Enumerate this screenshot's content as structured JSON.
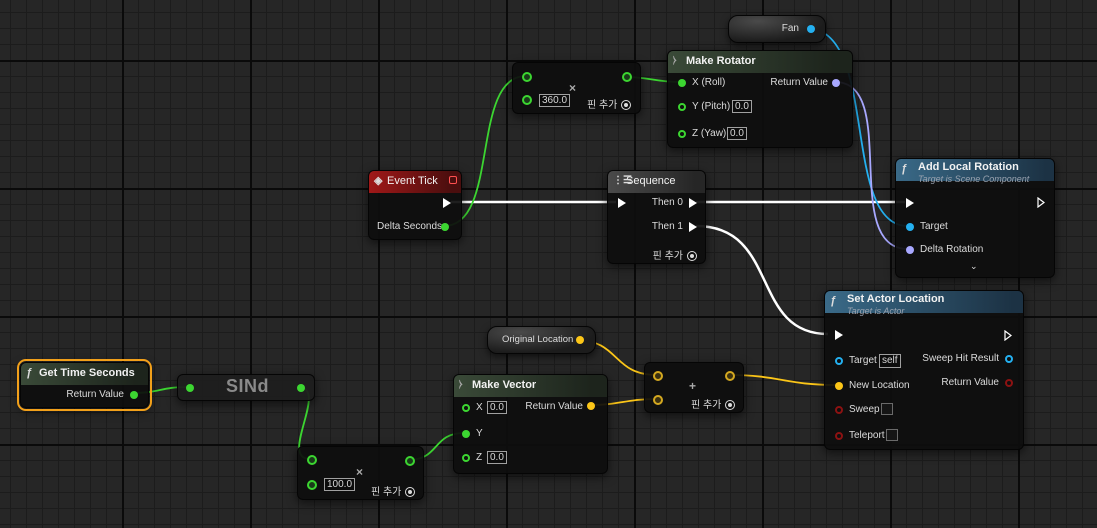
{
  "nodes": {
    "fan": {
      "label": "Fan"
    },
    "multiply_top": {
      "b_value": "360.0",
      "add_pin": "핀 추가"
    },
    "make_rotator": {
      "title": "Make Rotator",
      "x_label": "X (Roll)",
      "y_label": "Y (Pitch)",
      "y_value": "0.0",
      "z_label": "Z (Yaw)",
      "z_value": "0.0",
      "return_label": "Return Value"
    },
    "event_tick": {
      "title": "Event Tick",
      "delta_label": "Delta Seconds"
    },
    "sequence": {
      "title": "Sequence",
      "then0": "Then 0",
      "then1": "Then 1",
      "add_pin": "핀 추가"
    },
    "add_local_rotation": {
      "title": "Add Local Rotation",
      "subtitle": "Target is Scene Component",
      "target_label": "Target",
      "delta_label": "Delta Rotation"
    },
    "set_actor_location": {
      "title": "Set Actor Location",
      "subtitle": "Target is Actor",
      "target_label": "Target",
      "target_value": "self",
      "new_location_label": "New Location",
      "sweep_label": "Sweep",
      "teleport_label": "Teleport",
      "sweep_hit_label": "Sweep Hit Result",
      "return_label": "Return Value"
    },
    "original_location": {
      "label": "Original Location"
    },
    "add_vector": {
      "add_pin": "핀 추가"
    },
    "get_time_seconds": {
      "title": "Get Time Seconds",
      "return_label": "Return Value"
    },
    "sind": {
      "title": "SINd"
    },
    "make_vector": {
      "title": "Make Vector",
      "x_label": "X",
      "x_value": "0.0",
      "y_label": "Y",
      "z_label": "Z",
      "z_value": "0.0",
      "return_label": "Return Value"
    },
    "multiply_bottom": {
      "b_value": "100.0",
      "add_pin": "핀 추가"
    }
  },
  "colors": {
    "exec": "#ffffff",
    "float": "#3cd631",
    "object": "#24b0f0",
    "rotator": "#a8a8ff",
    "vector": "#fcc618",
    "bool": "#8c1212",
    "event_header": "#a01818",
    "function_header": "#3a6a88",
    "selection": "#f2a01a"
  },
  "icons": {
    "function": "function-icon",
    "event": "event-diamond-icon",
    "sequence": "sequence-icon",
    "struct": "struct-icon",
    "multiply": "multiply-icon",
    "add": "plus-icon",
    "chevron": "chevron-down-icon"
  },
  "connections": [
    "event_tick.exec -> sequence.exec",
    "sequence.then0 -> add_local_rotation.exec",
    "sequence.then1 -> set_actor_location.exec",
    "event_tick.delta_seconds -> multiply_top.a",
    "multiply_top.result -> make_rotator.x",
    "make_rotator.return -> add_local_rotation.delta_rotation",
    "fan -> add_local_rotation.target",
    "get_time_seconds.return -> sind.input",
    "sind.output -> multiply_bottom.a",
    "multiply_bottom.result -> make_vector.y",
    "make_vector.return -> add_vector.b",
    "original_location -> add_vector.a",
    "add_vector.result -> set_actor_location.new_location"
  ]
}
